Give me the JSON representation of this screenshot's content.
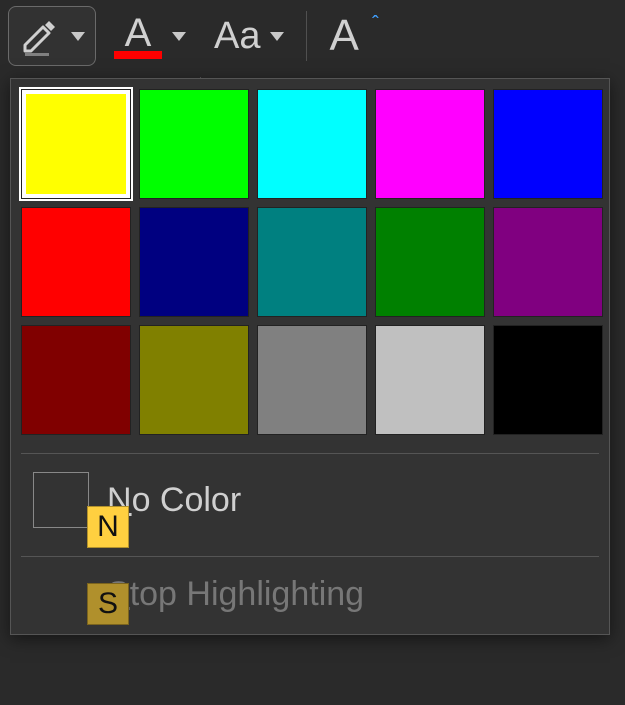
{
  "toolbar": {
    "highlighter_label": "Highlighter",
    "font_color_label": "Font Color",
    "font_color_accent": "#ff0000",
    "change_case_label": "Aa",
    "superscript_label": "A"
  },
  "palette": {
    "swatches": [
      {
        "name": "yellow",
        "hex": "#ffff00",
        "selected": true
      },
      {
        "name": "lime",
        "hex": "#00ff00",
        "selected": false
      },
      {
        "name": "cyan",
        "hex": "#00ffff",
        "selected": false
      },
      {
        "name": "magenta",
        "hex": "#ff00ff",
        "selected": false
      },
      {
        "name": "blue",
        "hex": "#0000ff",
        "selected": false
      },
      {
        "name": "red",
        "hex": "#ff0000",
        "selected": false
      },
      {
        "name": "navy",
        "hex": "#000080",
        "selected": false
      },
      {
        "name": "teal",
        "hex": "#008080",
        "selected": false
      },
      {
        "name": "green",
        "hex": "#008000",
        "selected": false
      },
      {
        "name": "purple",
        "hex": "#800080",
        "selected": false
      },
      {
        "name": "maroon",
        "hex": "#800000",
        "selected": false
      },
      {
        "name": "olive",
        "hex": "#808000",
        "selected": false
      },
      {
        "name": "gray",
        "hex": "#808080",
        "selected": false
      },
      {
        "name": "silver",
        "hex": "#c0c0c0",
        "selected": false
      },
      {
        "name": "black",
        "hex": "#000000",
        "selected": false
      }
    ],
    "no_color_label": "No Color",
    "no_color_shortcut": "N",
    "stop_label": "Stop Highlighting",
    "stop_shortcut": "S",
    "stop_enabled": false
  }
}
